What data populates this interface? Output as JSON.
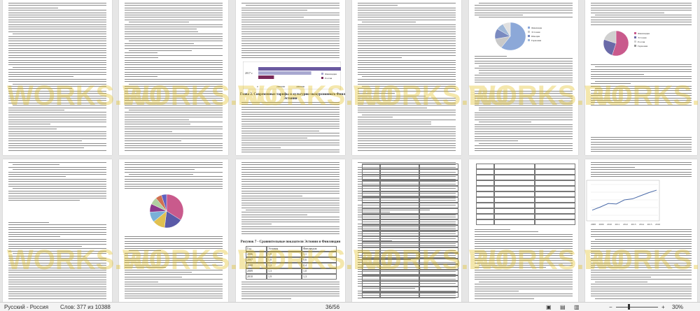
{
  "status_bar": {
    "language": "Русский - Россия",
    "word_count": "Слов: 377 из 10388",
    "page_counter": "36/56",
    "zoom_percent": "30%",
    "zoom_minus": "−",
    "zoom_plus": "+"
  },
  "page3": {
    "heading_line1": "Глава 2. Современные тарифы и культурно-экскурсионного Финляндии в",
    "heading_line2": "Эстонии",
    "chart": {
      "year_label": "2017 г.",
      "tick_0": "0",
      "tick_1": "2000000",
      "tick_2": "4000000",
      "legend": [
        "Эстония",
        "Финляндия",
        "Россия"
      ]
    }
  },
  "page5": {
    "legend": [
      "Финляндия",
      "Эстония",
      "Швеция",
      "Германия"
    ]
  },
  "page6": {
    "legend": [
      "Финляндия",
      "Эстония",
      "Россия",
      "Германия"
    ]
  },
  "page7": {
    "heading": "Рисунок 7 - Сравнительные показатели Эстонии и Финляндии",
    "table_left": {
      "header": [
        "Год",
        "Эстония",
        "Финляндия"
      ],
      "rows": [
        [
          "2006",
          "1,9",
          "1,1"
        ],
        [
          "2007",
          "1,8",
          "0,6"
        ],
        [
          "2008",
          "1,2",
          "0,4"
        ],
        [
          "2009",
          "1,3",
          "1,0"
        ],
        [
          "2010",
          "1,9",
          "1,3"
        ]
      ]
    }
  },
  "page8": {
    "x_labels": [
      "2008",
      "2009",
      "2010",
      "2011",
      "2012",
      "2013",
      "2014",
      "2015",
      "2016"
    ],
    "table_rows": [
      "2006",
      "2007",
      "2008",
      "2009",
      "2010",
      "2011",
      "2012",
      "2013",
      "2014",
      "2015",
      "2016",
      "2017"
    ]
  },
  "chart_data": [
    {
      "type": "bar",
      "categories": [
        "2017 г."
      ],
      "series": [
        {
          "name": "Эстония",
          "values": [
            4300000
          ]
        },
        {
          "name": "Финляндия",
          "values": [
            2700000
          ]
        },
        {
          "name": "Россия",
          "values": [
            800000
          ]
        }
      ],
      "xlim": [
        0,
        4000000
      ]
    },
    {
      "type": "pie",
      "values": [
        34,
        18,
        12,
        10,
        8,
        7,
        6,
        5
      ]
    },
    {
      "type": "pie",
      "values": [
        60,
        12,
        12,
        8,
        8
      ]
    },
    {
      "type": "pie",
      "values": [
        55,
        25,
        20
      ]
    },
    {
      "type": "line",
      "x": [
        "2008",
        "2009",
        "2010",
        "2011",
        "2012",
        "2013",
        "2014",
        "2015",
        "2016"
      ],
      "values": [
        3.0,
        3.6,
        4.3,
        4.2,
        5.0,
        5.2,
        5.8,
        6.4,
        6.9
      ]
    }
  ],
  "colors": {
    "pie": [
      "#c95a8c",
      "#5a5aa8",
      "#e0c050",
      "#7ab0d8",
      "#8c3a8c",
      "#b0d0a0",
      "#d07050",
      "#6060c0"
    ],
    "bar": [
      "#6a5aa0",
      "#a8a8d0",
      "#7a2a5a"
    ],
    "line": "#4a6aa8"
  },
  "watermark": "WORKS.RU"
}
